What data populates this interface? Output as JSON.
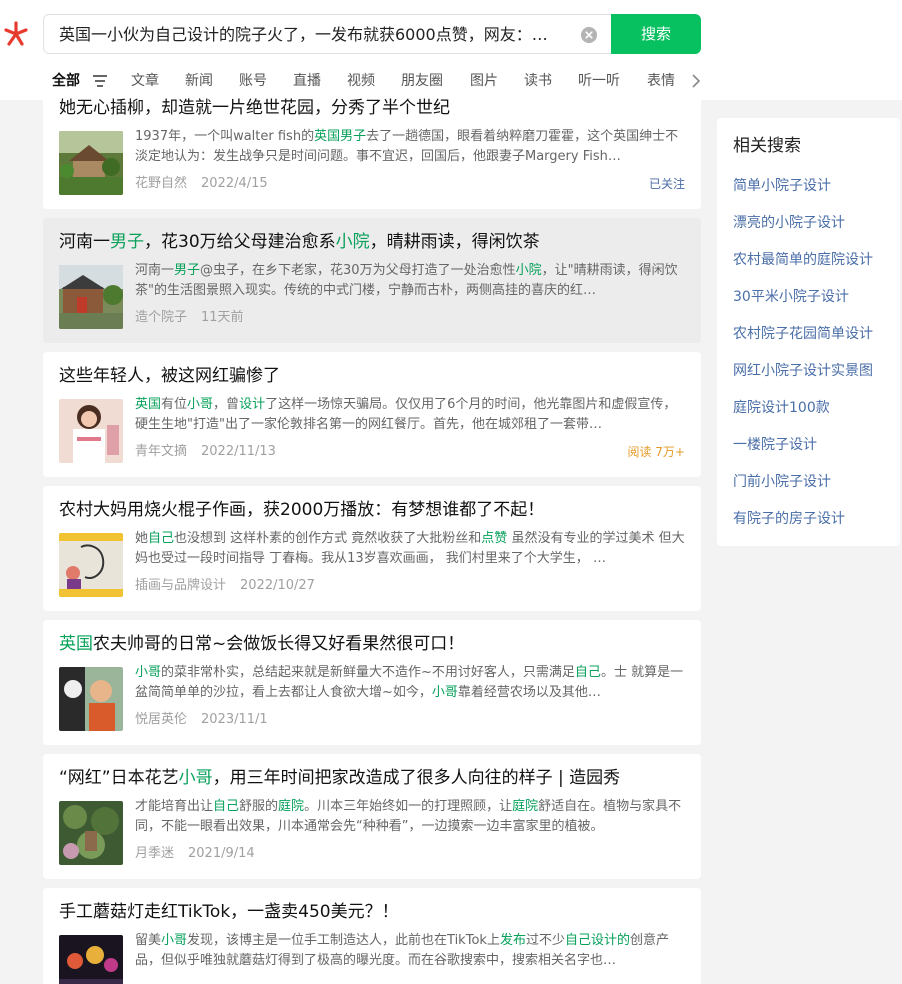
{
  "search": {
    "query": "英国一小伙为自己设计的院子火了，一发布就获6000点赞，网友：…",
    "button_label": "搜索"
  },
  "tabs": [
    "全部",
    "文章",
    "新闻",
    "账号",
    "直播",
    "视频",
    "朋友圈",
    "图片",
    "读书",
    "听一听",
    "表情"
  ],
  "results": [
    {
      "title": [
        {
          "t": "她无心插柳，却造就一片绝世花园，分秀了半个世纪"
        }
      ],
      "desc": [
        {
          "t": "1937年，一个叫walter fish的"
        },
        {
          "t": "英国男子",
          "h": true
        },
        {
          "t": "去了一趟德国，眼看着纳粹磨刀霍霍，这个英国绅士不淡定地认为：发生战争只是时间问题。事不宜迟，回国后，他跟妻子Margery Fish…"
        }
      ],
      "source": "花野自然",
      "date": "2022/4/15",
      "aux": "已关注",
      "aux_color": "#4a6ea8"
    },
    {
      "title": [
        {
          "t": "河南一"
        },
        {
          "t": "男子",
          "h": true
        },
        {
          "t": "，花30万给父母建治愈系"
        },
        {
          "t": "小院",
          "h": true
        },
        {
          "t": "，晴耕雨读，得闲饮茶"
        }
      ],
      "desc": [
        {
          "t": "河南一"
        },
        {
          "t": "男子",
          "h": true
        },
        {
          "t": "@虫子，在乡下老家，花30万为父母打造了一处治愈性"
        },
        {
          "t": "小院",
          "h": true
        },
        {
          "t": "，让\"晴耕雨读，得闲饮茶\"的生活图景照入现实。传统的中式门楼，宁静而古朴，两侧高挂的喜庆的红…"
        }
      ],
      "source": "造个院子",
      "date": "11天前",
      "aux": "",
      "aux_color": ""
    },
    {
      "title": [
        {
          "t": "这些年轻人，被这网红骗惨了"
        }
      ],
      "desc": [
        {
          "t": "英国",
          "h": true
        },
        {
          "t": "有位"
        },
        {
          "t": "小哥",
          "h": true
        },
        {
          "t": "，曾"
        },
        {
          "t": "设计",
          "h": true
        },
        {
          "t": "了这样一场惊天骗局。仅仅用了6个月的时间，他光靠图片和虚假宣传，硬生生地\"打造\"出了一家伦敦排名第一的网红餐厅。首先，他在城郊租了一套带…"
        }
      ],
      "source": "青年文摘",
      "date": "2022/11/13",
      "aux": "阅读 7万+",
      "aux_color": "#e59b2a"
    },
    {
      "title": [
        {
          "t": "农村大妈用烧火棍子作画，获2000万播放：有梦想谁都了不起！"
        }
      ],
      "desc": [
        {
          "t": "她"
        },
        {
          "t": "自己",
          "h": true
        },
        {
          "t": "也没想到 这样朴素的创作方式 竟然收获了大批粉丝和"
        },
        {
          "t": "点赞",
          "h": true
        },
        {
          "t": " 虽然没有专业的学过美术 但大妈也受过一段时间指导 丁春梅。我从13岁喜欢画画， 我们村里来了个大学生， …"
        }
      ],
      "source": "插画与品牌设计",
      "date": "2022/10/27",
      "aux": "",
      "aux_color": ""
    },
    {
      "title": [
        {
          "t": "英国",
          "h": true
        },
        {
          "t": "农夫帅哥的日常~会做饭长得又好看果然很可口！"
        }
      ],
      "desc": [
        {
          "t": "小哥",
          "h": true
        },
        {
          "t": "的菜非常朴实，总结起来就是新鲜量大不造作~不用讨好客人，只需满足"
        },
        {
          "t": "自己",
          "h": true
        },
        {
          "t": "。士 就算是一盆简简单单的沙拉，看上去都让人食欲大增~如今，"
        },
        {
          "t": "小哥",
          "h": true
        },
        {
          "t": "靠着经营农场以及其他…"
        }
      ],
      "source": "悦居英伦",
      "date": "2023/11/1",
      "aux": "",
      "aux_color": ""
    },
    {
      "title": [
        {
          "t": "“网红”日本花艺"
        },
        {
          "t": "小哥",
          "h": true
        },
        {
          "t": "，用三年时间把家改造成了很多人向往的样子 | 造园秀"
        }
      ],
      "desc": [
        {
          "t": "才能培育出让"
        },
        {
          "t": "自己",
          "h": true
        },
        {
          "t": "舒服的"
        },
        {
          "t": "庭院",
          "h": true
        },
        {
          "t": "。川本三年始终如一的打理照顾，让"
        },
        {
          "t": "庭院",
          "h": true
        },
        {
          "t": "舒适自在。植物与家具不同，不能一眼看出效果，川本通常会先“种种看”，一边摸索一边丰富家里的植被。"
        }
      ],
      "source": "月季迷",
      "date": "2021/9/14",
      "aux": "",
      "aux_color": ""
    },
    {
      "title": [
        {
          "t": "手工蘑菇灯走红TikTok，一盏卖450美元？！"
        }
      ],
      "desc": [
        {
          "t": "留美"
        },
        {
          "t": "小哥",
          "h": true
        },
        {
          "t": "发现，该博主是一位手工制造达人，此前也在TikTok上"
        },
        {
          "t": "发布",
          "h": true
        },
        {
          "t": "过不少"
        },
        {
          "t": "自己设计的",
          "h": true
        },
        {
          "t": "创意产品，但似乎唯独就蘑菇灯得到了极高的曝光度。而在谷歌搜索中，搜索相关名字也…"
        }
      ],
      "source": "",
      "date": "",
      "aux": "",
      "aux_color": ""
    }
  ],
  "related": {
    "title": "相关搜索",
    "items": [
      "简单小院子设计",
      "漂亮的小院子设计",
      "农村最简单的庭院设计",
      "30平米小院子设计",
      "农村院子花园简单设计",
      "网红小院子设计实景图",
      "庭院设计100款",
      "一楼院子设计",
      "门前小院子设计",
      "有院子的房子设计"
    ]
  },
  "colors": {
    "accent": "#07c160",
    "highlight": "#07a15a",
    "link": "#4a6ea8"
  }
}
